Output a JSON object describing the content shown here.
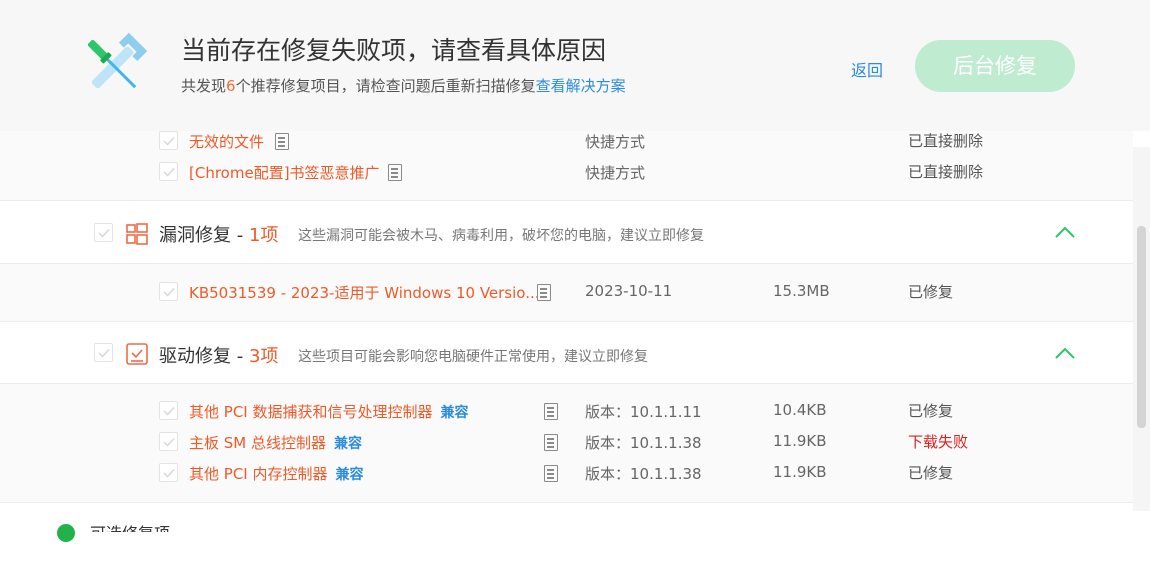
{
  "header": {
    "title": "当前存在修复失败项，请查看具体原因",
    "subtitle_prefix": "共发现",
    "subtitle_count": "6",
    "subtitle_mid": "个推荐修复项目，请检查问题后重新扫描修复",
    "subtitle_link": "查看解决方案",
    "back_label": "返回",
    "background_repair_label": "后台修复"
  },
  "top_items": [
    {
      "name": "无效的文件",
      "type": "快捷方式",
      "status": "已直接删除"
    },
    {
      "name": "[Chrome配置]书签恶意推广",
      "type": "快捷方式",
      "status": "已直接删除"
    }
  ],
  "sections": [
    {
      "title": "漏洞修复",
      "dash": " - ",
      "count": "1项",
      "desc": "这些漏洞可能会被木马、病毒利用，破坏您的电脑，建议立即修复",
      "items": [
        {
          "name": "KB5031539 - 2023-适用于 Windows 10 Versio...",
          "type": "2023-10-11",
          "size": "15.3MB",
          "status": "已修复"
        }
      ]
    },
    {
      "title": "驱动修复",
      "dash": " - ",
      "count": "3项",
      "desc": "这些项目可能会影响您电脑硬件正常使用，建议立即修复",
      "items": [
        {
          "name": "其他 PCI 数据捕获和信号处理控制器",
          "tag": "兼容",
          "type": "版本：10.1.1.11",
          "size": "10.4KB",
          "status": "已修复"
        },
        {
          "name": "主板 SM 总线控制器",
          "tag": "兼容",
          "type": "版本：10.1.1.38",
          "size": "11.9KB",
          "status": "下载失败"
        },
        {
          "name": "其他 PCI 内存控制器",
          "tag": "兼容",
          "type": "版本：10.1.1.38",
          "size": "11.9KB",
          "status": "已修复"
        }
      ]
    }
  ],
  "optional": {
    "label": "可选修复项"
  },
  "colors": {
    "accent_green": "#2dc66a",
    "button_bg": "#bfebd0",
    "warn": "#f05a28",
    "link": "#2a8cdb",
    "fail": "#e02020"
  }
}
